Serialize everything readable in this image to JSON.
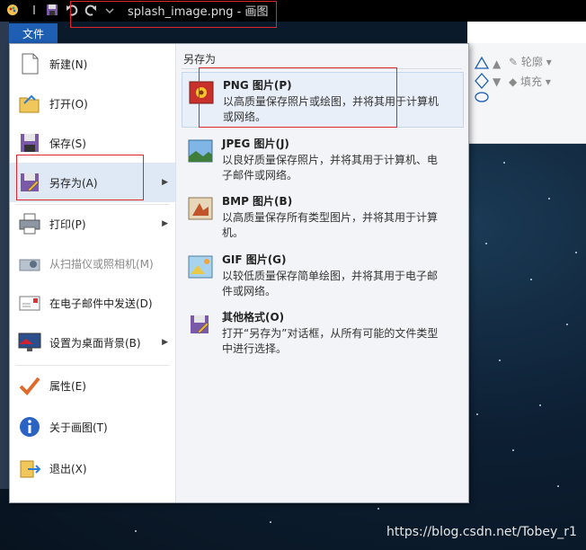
{
  "window": {
    "title": "splash_image.png - 画图"
  },
  "ribbon": {
    "file_tab": "文件",
    "outline_label": "轮廓",
    "fill_label": "填充"
  },
  "menu": {
    "items": [
      {
        "label": "新建(N)"
      },
      {
        "label": "打开(O)"
      },
      {
        "label": "保存(S)"
      },
      {
        "label": "另存为(A)"
      },
      {
        "label": "打印(P)"
      },
      {
        "label": "从扫描仪或照相机(M)"
      },
      {
        "label": "在电子邮件中发送(D)"
      },
      {
        "label": "设置为桌面背景(B)"
      },
      {
        "label": "属性(E)"
      },
      {
        "label": "关于画图(T)"
      },
      {
        "label": "退出(X)"
      }
    ]
  },
  "save_as": {
    "header": "另存为",
    "options": [
      {
        "title": "PNG 图片(P)",
        "desc": "以高质量保存照片或绘图，并将其用于计算机或网络。"
      },
      {
        "title": "JPEG 图片(J)",
        "desc": "以良好质量保存照片，并将其用于计算机、电子邮件或网络。"
      },
      {
        "title": "BMP 图片(B)",
        "desc": "以高质量保存所有类型图片，并将其用于计算机。"
      },
      {
        "title": "GIF 图片(G)",
        "desc": "以较低质量保存简单绘图，并将其用于电子邮件或网络。"
      },
      {
        "title": "其他格式(O)",
        "desc": "打开“另存为”对话框，从所有可能的文件类型中进行选择。"
      }
    ]
  },
  "watermark": "https://blog.csdn.net/Tobey_r1",
  "colors": {
    "accent": "#1e5eb3",
    "highlight_border": "#e0262b",
    "menu_hover": "#dfe8f5"
  }
}
